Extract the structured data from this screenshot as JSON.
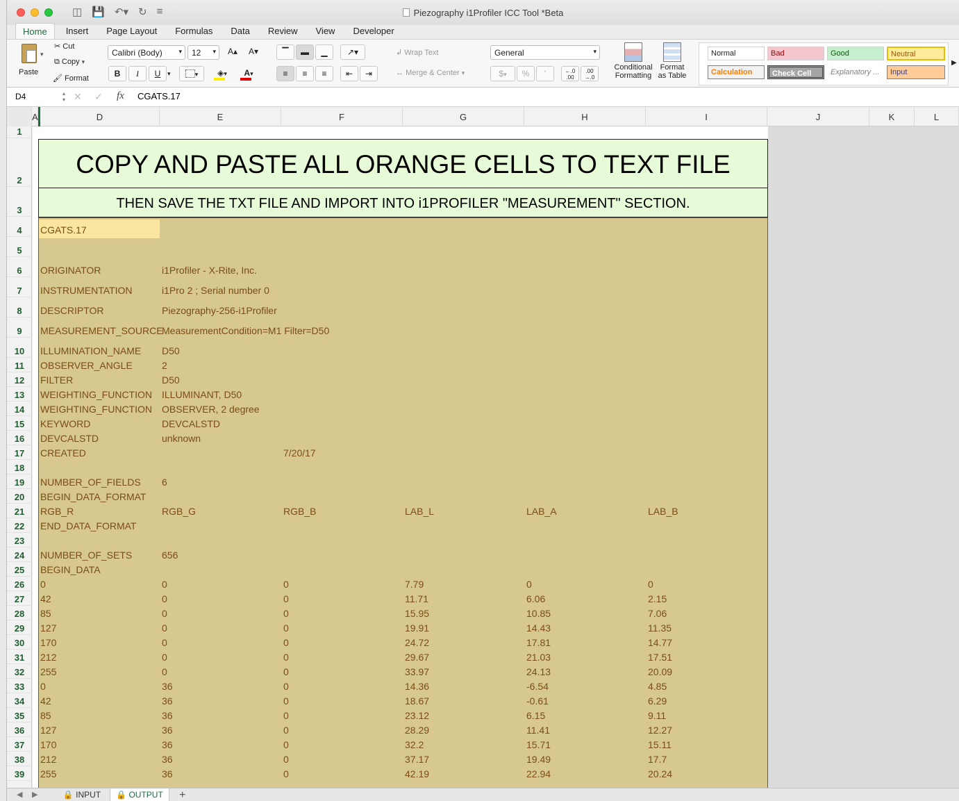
{
  "window": {
    "title": "Piezography i1Profiler ICC Tool *Beta"
  },
  "ribbon_tabs": [
    "Home",
    "Insert",
    "Page Layout",
    "Formulas",
    "Data",
    "Review",
    "View",
    "Developer"
  ],
  "clipboard": {
    "paste": "Paste",
    "cut": "Cut",
    "copy": "Copy",
    "format": "Format"
  },
  "font": {
    "name": "Calibri (Body)",
    "size": "12",
    "bold": "B",
    "italic": "I",
    "underline": "U"
  },
  "alignment": {
    "wrap_text": "Wrap Text",
    "merge_center": "Merge & Center"
  },
  "number": {
    "format": "General",
    "currency": "$",
    "percent": "%",
    "comma": "’",
    "inc_decimal": "←.0 .00",
    "dec_decimal": ".00 →.0"
  },
  "styles": {
    "conditional": "Conditional Formatting",
    "format_table": "Format as Table",
    "cells": [
      {
        "label": "Normal",
        "bg": "#ffffff",
        "fg": "#000000"
      },
      {
        "label": "Bad",
        "bg": "#f4c7ce",
        "fg": "#9c0006"
      },
      {
        "label": "Good",
        "bg": "#c6efce",
        "fg": "#006100"
      },
      {
        "label": "Neutral",
        "bg": "#ffeb9c",
        "fg": "#9c5700"
      },
      {
        "label": "Calculation",
        "bg": "#f2f2f2",
        "fg": "#fa7d00"
      },
      {
        "label": "Check Cell",
        "bg": "#a5a5a5",
        "fg": "#ffffff"
      },
      {
        "label": "Explanatory ...",
        "bg": "#ffffff",
        "fg": "#7f7f7f"
      },
      {
        "label": "Input",
        "bg": "#ffcc99",
        "fg": "#3f3f76"
      }
    ]
  },
  "formula_bar": {
    "cell_ref": "D4",
    "fx": "fx",
    "content": "CGATS.17"
  },
  "columns": [
    "A",
    "D",
    "E",
    "F",
    "G",
    "H",
    "I",
    "J",
    "K",
    "L"
  ],
  "rows": [
    "1",
    "2",
    "3",
    "4",
    "5",
    "6",
    "7",
    "8",
    "9",
    "10",
    "11",
    "12",
    "13",
    "14",
    "15",
    "16",
    "17",
    "18",
    "19",
    "20",
    "21",
    "22",
    "23",
    "24",
    "25",
    "26",
    "27",
    "28",
    "29",
    "30",
    "31",
    "32",
    "33",
    "34",
    "35",
    "36",
    "37",
    "38",
    "39"
  ],
  "banner": {
    "line1": "COPY AND PASTE ALL ORANGE CELLS TO TEXT FILE",
    "line2": "THEN SAVE THE TXT FILE AND IMPORT INTO i1PROFILER \"MEASUREMENT\" SECTION."
  },
  "sheet_rows": [
    [
      "CGATS.17"
    ],
    [],
    [
      "ORIGINATOR",
      "i1Profiler - X-Rite, Inc."
    ],
    [
      "INSTRUMENTATION",
      "i1Pro 2 ; Serial number 0"
    ],
    [
      "DESCRIPTOR",
      "Piezography-256-i1Profiler"
    ],
    [
      "MEASUREMENT_SOURCE",
      "MeasurementCondition=M1 Filter=D50"
    ],
    [
      "ILLUMINATION_NAME",
      "D50"
    ],
    [
      "OBSERVER_ANGLE",
      "2"
    ],
    [
      "FILTER",
      "D50"
    ],
    [
      "WEIGHTING_FUNCTION",
      "ILLUMINANT, D50"
    ],
    [
      "WEIGHTING_FUNCTION",
      "OBSERVER, 2 degree"
    ],
    [
      "KEYWORD",
      "DEVCALSTD"
    ],
    [
      "DEVCALSTD",
      "unknown"
    ],
    [
      "CREATED",
      "",
      "7/20/17"
    ],
    [],
    [
      "NUMBER_OF_FIELDS",
      "6"
    ],
    [
      "BEGIN_DATA_FORMAT"
    ],
    [
      "RGB_R",
      "RGB_G",
      "RGB_B",
      "LAB_L",
      "LAB_A",
      "LAB_B"
    ],
    [
      "END_DATA_FORMAT"
    ],
    [],
    [
      "NUMBER_OF_SETS",
      "656"
    ],
    [
      "BEGIN_DATA"
    ],
    [
      "0",
      "0",
      "0",
      "7.79",
      "0",
      "0"
    ],
    [
      "42",
      "0",
      "0",
      "11.71",
      "6.06",
      "2.15"
    ],
    [
      "85",
      "0",
      "0",
      "15.95",
      "10.85",
      "7.06"
    ],
    [
      "127",
      "0",
      "0",
      "19.91",
      "14.43",
      "11.35"
    ],
    [
      "170",
      "0",
      "0",
      "24.72",
      "17.81",
      "14.77"
    ],
    [
      "212",
      "0",
      "0",
      "29.67",
      "21.03",
      "17.51"
    ],
    [
      "255",
      "0",
      "0",
      "33.97",
      "24.13",
      "20.09"
    ],
    [
      "0",
      "36",
      "0",
      "14.36",
      "-6.54",
      "4.85"
    ],
    [
      "42",
      "36",
      "0",
      "18.67",
      "-0.61",
      "6.29"
    ],
    [
      "85",
      "36",
      "0",
      "23.12",
      "6.15",
      "9.11"
    ],
    [
      "127",
      "36",
      "0",
      "28.29",
      "11.41",
      "12.27"
    ],
    [
      "170",
      "36",
      "0",
      "32.2",
      "15.71",
      "15.11"
    ],
    [
      "212",
      "36",
      "0",
      "37.17",
      "19.49",
      "17.7"
    ],
    [
      "255",
      "36",
      "0",
      "42.19",
      "22.94",
      "20.24"
    ]
  ],
  "sheet_tabs": [
    "INPUT",
    "OUTPUT"
  ]
}
